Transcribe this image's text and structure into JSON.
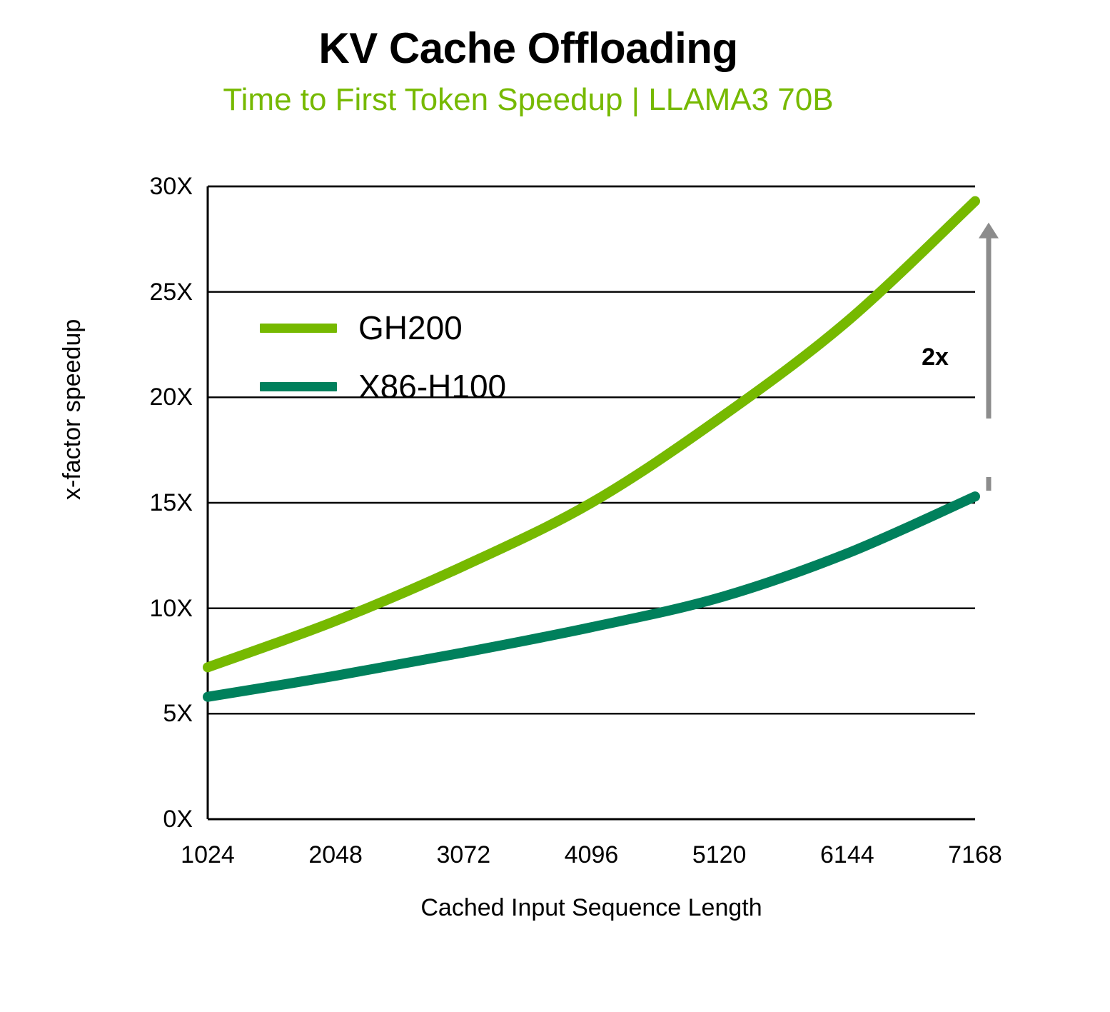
{
  "chart_data": {
    "type": "line",
    "title": "KV Cache Offloading",
    "subtitle": "Time to First Token Speedup | LLAMA3 70B",
    "xlabel": "Cached Input Sequence Length",
    "ylabel": "x-factor speedup",
    "x": [
      1024,
      2048,
      3072,
      4096,
      5120,
      6144,
      7168
    ],
    "xtick_labels": [
      "1024",
      "2048",
      "3072",
      "4096",
      "5120",
      "6144",
      "7168"
    ],
    "ytick_values": [
      0,
      5,
      10,
      15,
      20,
      25,
      30
    ],
    "ytick_labels": [
      "0X",
      "5X",
      "10X",
      "15X",
      "20X",
      "25X",
      "30X"
    ],
    "xlim": [
      1024,
      7168
    ],
    "ylim": [
      0,
      30
    ],
    "grid": "horizontal",
    "legend_position": "upper-left-inside",
    "series": [
      {
        "name": "GH200",
        "color": "#76b900",
        "values": [
          7.2,
          9.4,
          12.0,
          15.0,
          19.0,
          23.6,
          29.3
        ]
      },
      {
        "name": "X86-H100",
        "color": "#00805c",
        "values": [
          5.8,
          6.8,
          7.9,
          9.1,
          10.5,
          12.6,
          15.3
        ]
      }
    ],
    "annotations": [
      {
        "label": "2x",
        "kind": "arrow-gap-label",
        "at_x": 7168,
        "from_value": 15.3,
        "to_value": 29.3,
        "color": "#8c8c8c"
      }
    ]
  },
  "colors": {
    "gh200": "#76b900",
    "x86_h100": "#00805c",
    "subtitle": "#76b900",
    "axis": "#000000",
    "grid": "#000000",
    "annotation_arrow": "#8c8c8c",
    "background": "#ffffff"
  }
}
